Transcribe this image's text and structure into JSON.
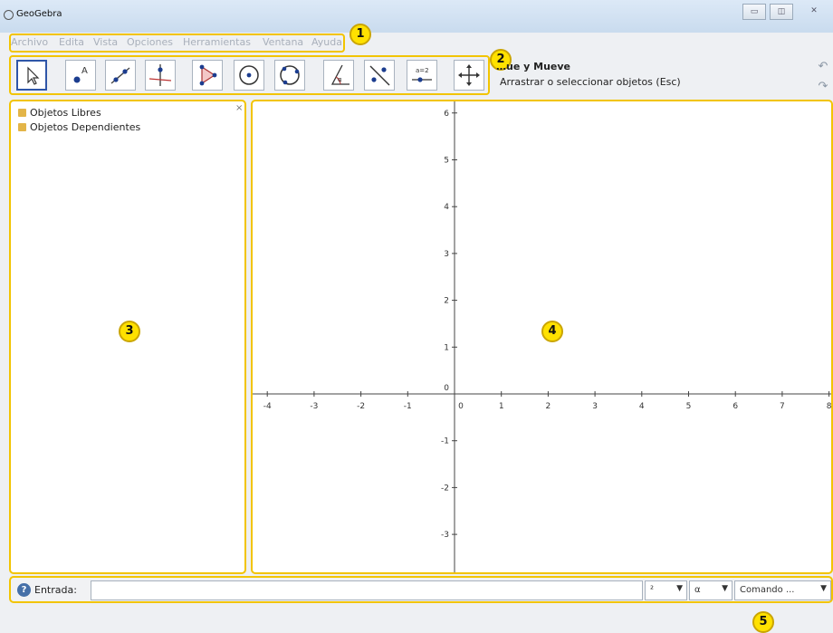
{
  "window": {
    "title": "GeoGebra",
    "controls": [
      "▭",
      "◫",
      "✕"
    ]
  },
  "menu": [
    "Archivo",
    "Edita",
    "Vista",
    "Opciones",
    "Herramientas",
    "Ventana",
    "Ayuda"
  ],
  "toolbar": {
    "tools": [
      "move-tool",
      "point-tool",
      "line-tool",
      "perpendicular-tool",
      "polygon-tool",
      "circle-tool",
      "conic-tool",
      "angle-tool",
      "reflect-tool",
      "slider-tool",
      "move-graphics-tool"
    ],
    "selected_tool_name": "…ue y Mueve",
    "selected_tool_help": "Arrastrar o seleccionar objetos (Esc)",
    "undo": "↶",
    "redo": "↷"
  },
  "algebra_view": {
    "close": "×",
    "folders": [
      "Objetos Libres",
      "Objetos Dependientes"
    ]
  },
  "graphics_view": {
    "x_ticks": [
      "-4",
      "-3",
      "-2",
      "-1",
      "0",
      "1",
      "2",
      "3",
      "4",
      "5",
      "6",
      "7",
      "8"
    ],
    "y_ticks": [
      "6",
      "5",
      "4",
      "3",
      "2",
      "1",
      "0",
      "-1",
      "-2",
      "-3"
    ]
  },
  "input_bar": {
    "help_icon": "?",
    "label": "Entrada:",
    "value": "",
    "symbol_combo": "²",
    "greek_combo": "α",
    "command_combo": "Comando ..."
  },
  "annotations": [
    "1",
    "2",
    "3",
    "4",
    "5"
  ],
  "colors": {
    "highlight": "#f2c400",
    "badge": "#ffe100",
    "selected_tool": "#2f56a8"
  }
}
